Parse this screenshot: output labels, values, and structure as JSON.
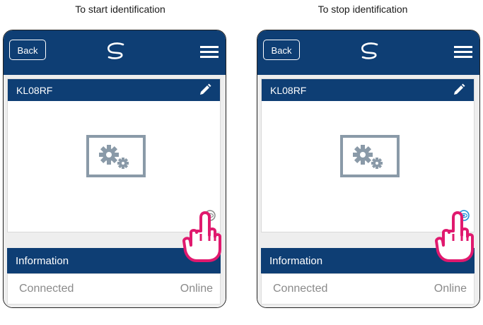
{
  "captions": {
    "left": "To start identification",
    "right": "To stop identification"
  },
  "app": {
    "back_label": "Back",
    "logo_icon": "swirl-logo-icon",
    "menu_icon": "hamburger-menu-icon"
  },
  "device": {
    "name": "KL08RF",
    "edit_icon": "pencil-icon",
    "image_icon": "gears-device-icon",
    "identify_icon": "eye-icon"
  },
  "information": {
    "title": "Information",
    "status_label": "Connected",
    "status_value": "Online"
  },
  "colors": {
    "brand": "#0e3e74",
    "background": "#eeeeee",
    "identify_off": "#8a8a8a",
    "identify_on": "#1b8fd8",
    "hand_outline": "#e0196e"
  }
}
